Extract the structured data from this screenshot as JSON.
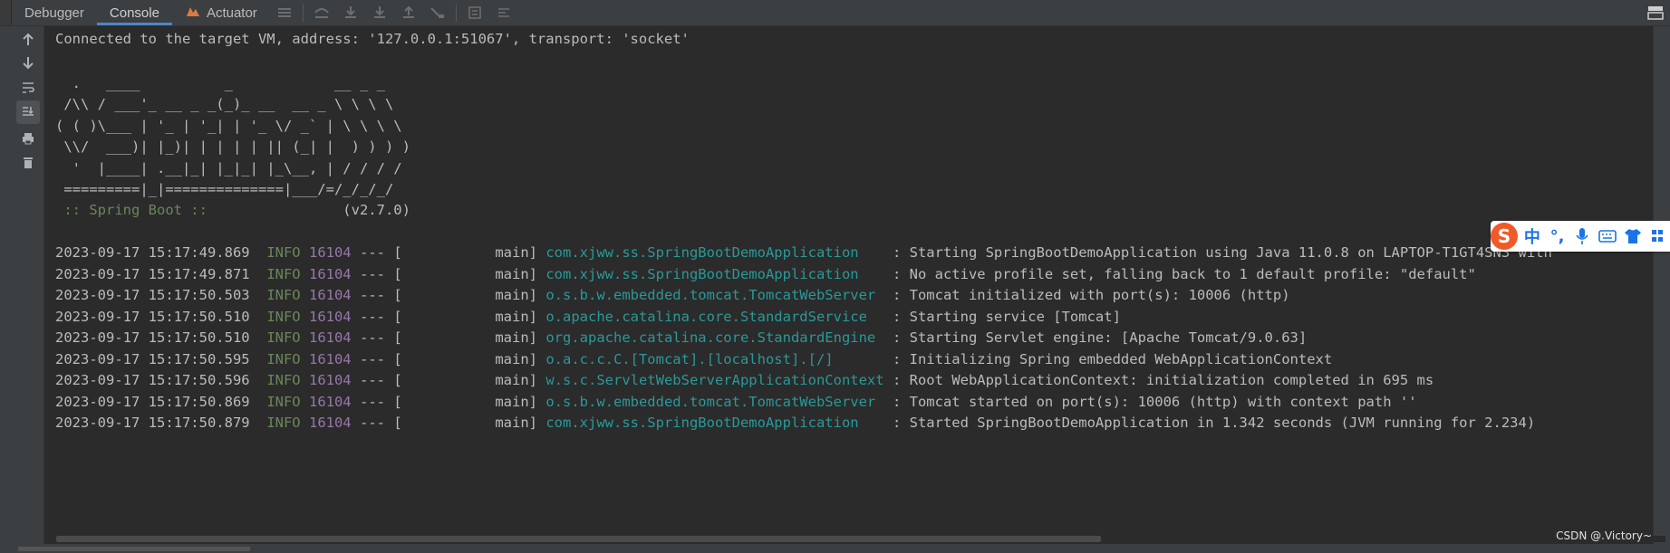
{
  "tabs": [
    {
      "label": "Debugger"
    },
    {
      "label": "Console"
    },
    {
      "label": "Actuator"
    }
  ],
  "active_tab": "Console",
  "colors": {
    "background": "#2b2b2b",
    "toolbar": "#3c3f41",
    "active_tab_underline": "#4a88c7",
    "text": "#bbbbbb",
    "info": "#6a8759",
    "pid": "#9876aa",
    "logger": "#299999"
  },
  "sidebar_icons": [
    "up-arrow-icon",
    "down-arrow-icon",
    "soft-wrap-icon",
    "scroll-to-end-icon",
    "print-icon",
    "trash-icon"
  ],
  "console": {
    "connected": "Connected to the target VM, address: '127.0.0.1:51067', transport: 'socket'",
    "banner": [
      "  .   ____          _            __ _ _",
      " /\\\\ / ___'_ __ _ _(_)_ __  __ _ \\ \\ \\ \\",
      "( ( )\\___ | '_ | '_| | '_ \\/ _` | \\ \\ \\ \\",
      " \\\\/  ___)| |_)| | | | | || (_| |  ) ) ) )",
      "  '  |____| .__|_| |_|_| |_\\__, | / / / /",
      " =========|_|==============|___/=/_/_/_/"
    ],
    "spring_label": " :: Spring Boot :: ",
    "spring_version": "               (v2.7.0)",
    "logs": [
      {
        "ts": "2023-09-17 15:17:49.869",
        "level": "INFO",
        "pid": "16104",
        "sep": "--- [",
        "thread": "           main]",
        "logger": "com.xjww.ss.SpringBootDemoApplication   ",
        "msg": ": Starting SpringBootDemoApplication using Java 11.0.8 on LAPTOP-T1GT4SN3 with"
      },
      {
        "ts": "2023-09-17 15:17:49.871",
        "level": "INFO",
        "pid": "16104",
        "sep": "--- [",
        "thread": "           main]",
        "logger": "com.xjww.ss.SpringBootDemoApplication   ",
        "msg": ": No active profile set, falling back to 1 default profile: \"default\""
      },
      {
        "ts": "2023-09-17 15:17:50.503",
        "level": "INFO",
        "pid": "16104",
        "sep": "--- [",
        "thread": "           main]",
        "logger": "o.s.b.w.embedded.tomcat.TomcatWebServer ",
        "msg": ": Tomcat initialized with port(s): 10006 (http)"
      },
      {
        "ts": "2023-09-17 15:17:50.510",
        "level": "INFO",
        "pid": "16104",
        "sep": "--- [",
        "thread": "           main]",
        "logger": "o.apache.catalina.core.StandardService  ",
        "msg": ": Starting service [Tomcat]"
      },
      {
        "ts": "2023-09-17 15:17:50.510",
        "level": "INFO",
        "pid": "16104",
        "sep": "--- [",
        "thread": "           main]",
        "logger": "org.apache.catalina.core.StandardEngine ",
        "msg": ": Starting Servlet engine: [Apache Tomcat/9.0.63]"
      },
      {
        "ts": "2023-09-17 15:17:50.595",
        "level": "INFO",
        "pid": "16104",
        "sep": "--- [",
        "thread": "           main]",
        "logger": "o.a.c.c.C.[Tomcat].[localhost].[/]      ",
        "msg": ": Initializing Spring embedded WebApplicationContext"
      },
      {
        "ts": "2023-09-17 15:17:50.596",
        "level": "INFO",
        "pid": "16104",
        "sep": "--- [",
        "thread": "           main]",
        "logger": "w.s.c.ServletWebServerApplicationContext",
        "msg": ": Root WebApplicationContext: initialization completed in 695 ms"
      },
      {
        "ts": "2023-09-17 15:17:50.869",
        "level": "INFO",
        "pid": "16104",
        "sep": "--- [",
        "thread": "           main]",
        "logger": "o.s.b.w.embedded.tomcat.TomcatWebServer ",
        "msg": ": Tomcat started on port(s): 10006 (http) with context path ''"
      },
      {
        "ts": "2023-09-17 15:17:50.879",
        "level": "INFO",
        "pid": "16104",
        "sep": "--- [",
        "thread": "           main]",
        "logger": "com.xjww.ss.SpringBootDemoApplication   ",
        "msg": ": Started SpringBootDemoApplication in 1.342 seconds (JVM running for 2.234)"
      }
    ]
  },
  "ime": {
    "logo": "S",
    "items": [
      "中",
      "°,",
      "mic-icon",
      "keyboard-icon",
      "shirt-icon",
      "grid-icon"
    ]
  },
  "watermark": "CSDN @.Victory~"
}
